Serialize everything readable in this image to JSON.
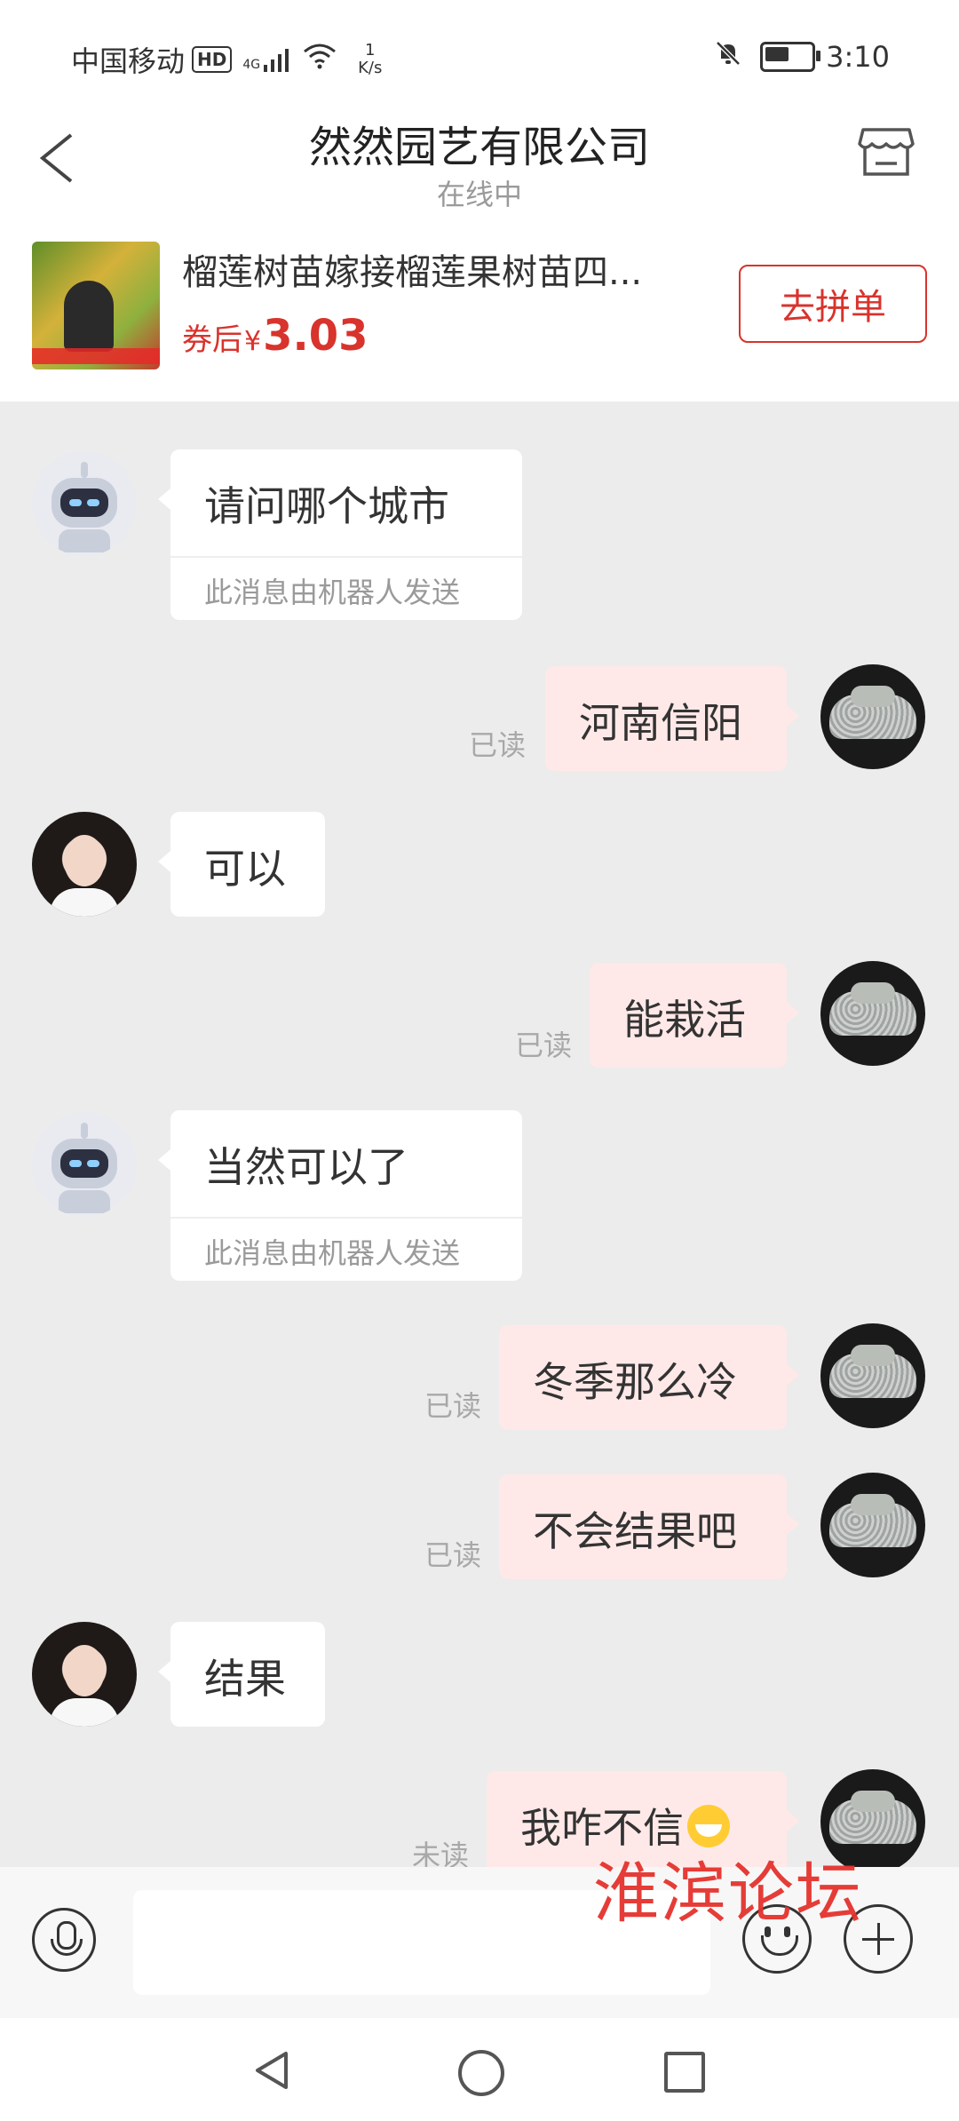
{
  "status_bar": {
    "carrier": "中国移动",
    "hd": "HD",
    "network": "4G",
    "speed_value": "1",
    "speed_unit": "K/s",
    "time": "3:10",
    "battery_level": 0.6
  },
  "header": {
    "title": "然然园艺有限公司",
    "subtitle": "在线中"
  },
  "product": {
    "title": "榴莲树苗嫁接榴莲果树苗四...",
    "price_prefix": "券后",
    "currency": "¥",
    "price": "3.03",
    "button_label": "去拼单"
  },
  "messages": [
    {
      "sender": "robot",
      "text": "请问哪个城市",
      "note": "此消息由机器人发送"
    },
    {
      "sender": "me",
      "text": "河南信阳",
      "read_state": "已读"
    },
    {
      "sender": "girl",
      "text": "可以"
    },
    {
      "sender": "me",
      "text": "能栽活",
      "read_state": "已读"
    },
    {
      "sender": "robot",
      "text": "当然可以了",
      "note": "此消息由机器人发送"
    },
    {
      "sender": "me",
      "text": "冬季那么冷",
      "read_state": "已读"
    },
    {
      "sender": "me",
      "text": "不会结果吧",
      "read_state": "已读"
    },
    {
      "sender": "girl",
      "text": "结果"
    },
    {
      "sender": "me",
      "text": "我咋不信",
      "read_state": "未读"
    }
  ],
  "input_bar": {
    "placeholder": ""
  },
  "watermark": "淮滨论坛",
  "colors": {
    "accent_red": "#d8332c",
    "my_bubble": "#ffe9e8",
    "chat_background": "#ececec"
  },
  "icons": [
    "back-arrow-icon",
    "store-icon",
    "microphone-icon",
    "emoji-icon",
    "plus-icon",
    "nav-back-icon",
    "nav-home-icon",
    "nav-recent-icon"
  ]
}
